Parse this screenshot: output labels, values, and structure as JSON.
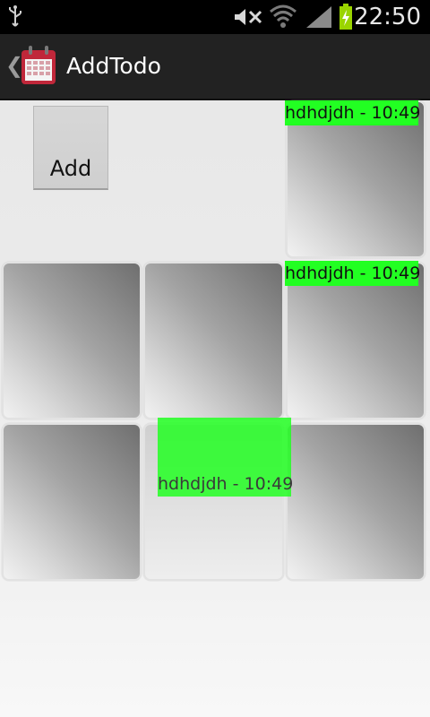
{
  "status_bar": {
    "time": "22:50",
    "icons": [
      "usb-icon",
      "mute-icon",
      "wifi-icon",
      "signal-icon",
      "battery-charging-icon"
    ]
  },
  "action_bar": {
    "back_icon": "chevron-left-icon",
    "app_icon": "calendar-icon",
    "title": "AddTodo"
  },
  "add_button": {
    "label": "Add"
  },
  "todos": [
    {
      "label": "hdhdjdh - 10:49"
    },
    {
      "label": "hdhdjdh - 10:49"
    },
    {
      "label": "hdhdjdh - 10:49"
    }
  ],
  "colors": {
    "todo_highlight": "#22ff22",
    "action_bar": "#222222",
    "status_bar": "#000000"
  }
}
